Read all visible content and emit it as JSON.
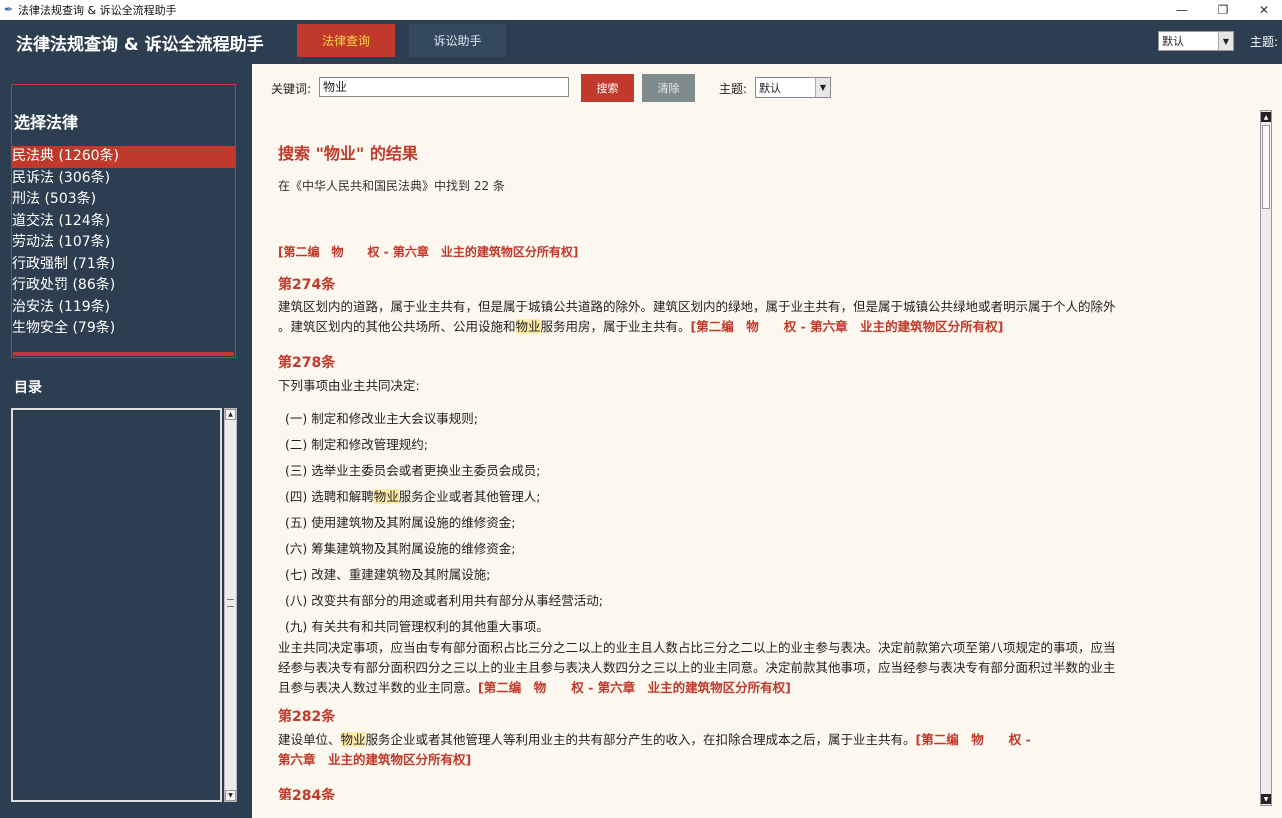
{
  "window": {
    "title": "法律法规查询 & 诉讼全流程助手",
    "controls": [
      "—",
      "❐",
      "✕"
    ]
  },
  "header": {
    "brand": "法律法规查询 & 诉讼全流程助手",
    "tabs": [
      {
        "label": "法律查询"
      },
      {
        "label": "诉讼助手"
      }
    ],
    "theme_value": "默认",
    "theme_label": "主题:"
  },
  "sidebar": {
    "law_title": "选择法律",
    "laws": [
      "民法典 (1260条)",
      "民诉法 (306条)",
      "刑法 (503条)",
      "道交法 (124条)",
      "劳动法 (107条)",
      "行政强制 (71条)",
      "行政处罚 (86条)",
      "治安法 (119条)",
      "生物安全 (79条)"
    ],
    "toc_title": "目录"
  },
  "search": {
    "label": "关键词:",
    "value": "物业",
    "search_btn": "搜索",
    "clear_btn": "清除",
    "theme_label": "主题:",
    "theme_value": "默认"
  },
  "results": {
    "title": "搜索 \"物业\" 的结果",
    "count": "在《中华人民共和国民法典》中找到 22 条",
    "path": "[第二编　物　　权 - 第六章　业主的建筑物区分所有权]",
    "a274": {
      "no": "第274条",
      "line1": "建筑区划内的道路，属于业主共有，但是属于城镇公共道路的除外。建筑区划内的绿地，属于业主共有，但是属于城镇公共绿地或者明示属于个人的除外",
      "line2a": "。建筑区划内的其他公共场所、公用设施和",
      "kw": "物业",
      "line2b": "服务用房，属于业主共有。"
    },
    "a278": {
      "no": "第278条",
      "intro": "下列事项由业主共同决定:",
      "items": [
        "(一) 制定和修改业主大会议事规则;",
        "(二) 制定和修改管理规约;",
        "(三) 选举业主委员会或者更换业主委员会成员;",
        "(四) 选聘和解聘",
        "(五) 使用建筑物及其附属设施的维修资金;",
        "(六) 筹集建筑物及其附属设施的维修资金;",
        "(七) 改建、重建建筑物及其附属设施;",
        "(八) 改变共有部分的用途或者利用共有部分从事经营活动;",
        "(九) 有关共有和共同管理权利的其他重大事项。"
      ],
      "item4_kw": "物业",
      "item4_tail": "服务企业或者其他管理人;",
      "para1": "业主共同决定事项，应当由专有部分面积占比三分之二以上的业主且人数占比三分之二以上的业主参与表决。决定前款第六项至第八项规定的事项，应当",
      "para2": "经参与表决专有部分面积四分之三以上的业主且参与表决人数四分之三以上的业主同意。决定前款其他事项，应当经参与表决专有部分面积过半数的业主",
      "para3": "且参与表决人数过半数的业主同意。"
    },
    "a282": {
      "no": "第282条",
      "pre": "建设单位、",
      "kw": "物业",
      "post": "服务企业或者其他管理人等利用业主的共有部分产生的收入，在扣除合理成本之后，属于业主共有。",
      "path_a": "[第二编　物　　权 -",
      "path_b": "第六章　业主的建筑物区分所有权]"
    },
    "a284_no": "第284条"
  }
}
